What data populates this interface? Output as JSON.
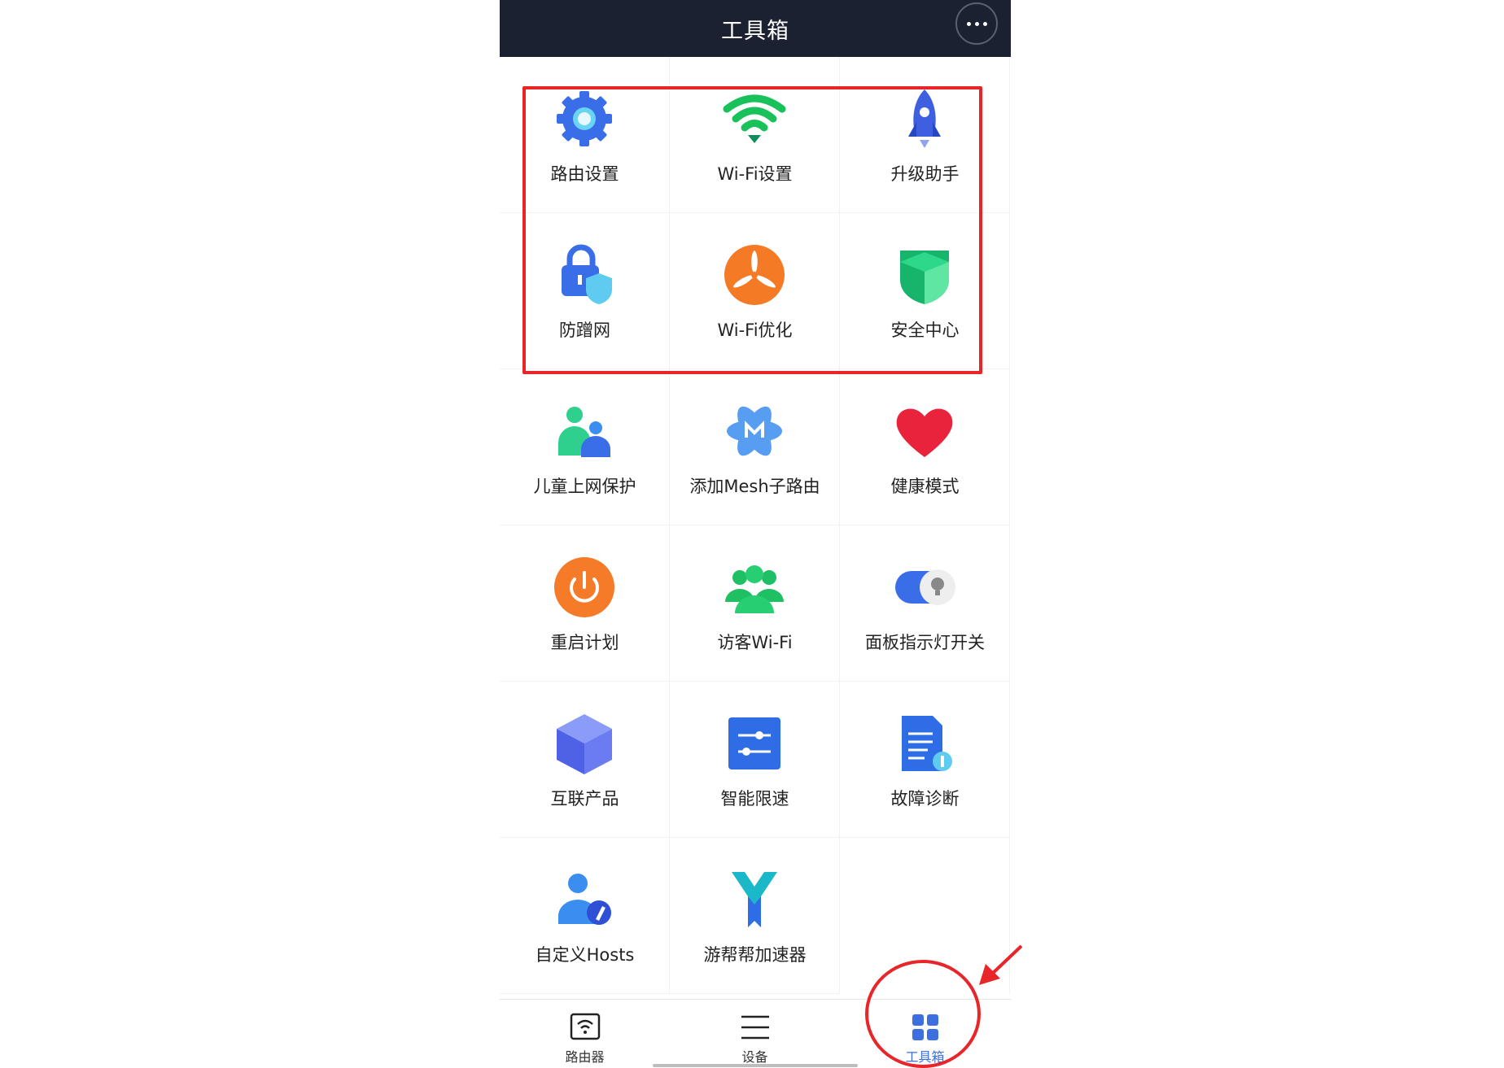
{
  "header": {
    "title": "工具箱",
    "more_icon": "more-icon"
  },
  "tools": [
    {
      "label": "路由设置",
      "icon": "gear-icon"
    },
    {
      "label": "Wi-Fi设置",
      "icon": "wifi-icon"
    },
    {
      "label": "升级助手",
      "icon": "rocket-icon"
    },
    {
      "label": "防蹭网",
      "icon": "lock-shield-icon"
    },
    {
      "label": "Wi-Fi优化",
      "icon": "fan-icon"
    },
    {
      "label": "安全中心",
      "icon": "shield-icon"
    },
    {
      "label": "儿童上网保护",
      "icon": "child-icon"
    },
    {
      "label": "添加Mesh子路由",
      "icon": "mesh-icon"
    },
    {
      "label": "健康模式",
      "icon": "heart-icon"
    },
    {
      "label": "重启计划",
      "icon": "power-icon"
    },
    {
      "label": "访客Wi-Fi",
      "icon": "guests-icon"
    },
    {
      "label": "面板指示灯开关",
      "icon": "toggle-bulb-icon"
    },
    {
      "label": "互联产品",
      "icon": "cube-icon"
    },
    {
      "label": "智能限速",
      "icon": "sliders-icon"
    },
    {
      "label": "故障诊断",
      "icon": "document-icon"
    },
    {
      "label": "自定义Hosts",
      "icon": "user-edit-icon"
    },
    {
      "label": "游帮帮加速器",
      "icon": "accelerator-icon"
    }
  ],
  "tabbar": {
    "items": [
      {
        "label": "路由器",
        "icon": "router-icon",
        "active": false
      },
      {
        "label": "设备",
        "icon": "list-icon",
        "active": false
      },
      {
        "label": "工具箱",
        "icon": "grid-icon",
        "active": true
      }
    ]
  },
  "colors": {
    "header_bg": "#1c2131",
    "accent": "#3d6fe0",
    "annotation": "#e8262a"
  }
}
